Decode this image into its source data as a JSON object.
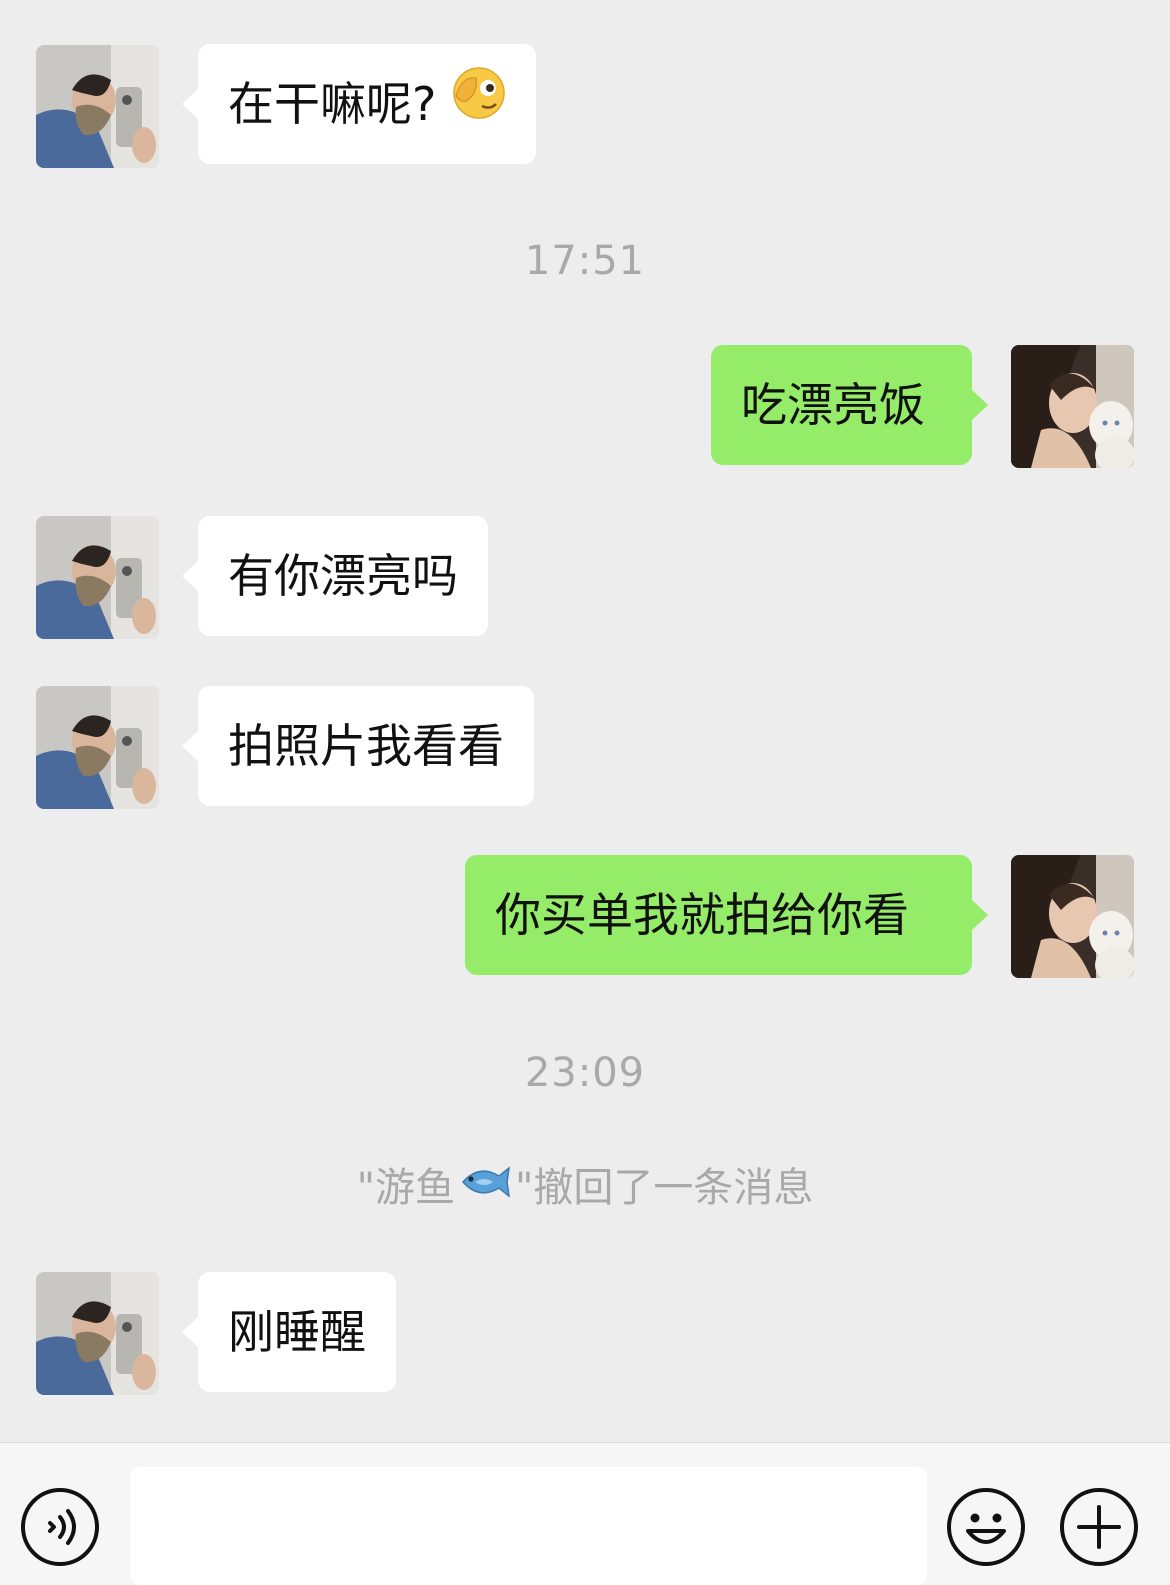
{
  "messages": {
    "m1": {
      "text": "在干嘛呢?",
      "emoji": "face-with-hand-over-eye-icon"
    },
    "t1": "17:51",
    "m2": {
      "text": "吃漂亮饭"
    },
    "m3": {
      "text": "有你漂亮吗"
    },
    "m4": {
      "text": "拍照片我看看"
    },
    "m5": {
      "text": "你买单我就拍给你看"
    },
    "t2": "23:09",
    "recall": {
      "prefix": "\"游鱼",
      "suffix": "\"撤回了一条消息",
      "emoji": "fish-icon"
    },
    "m6": {
      "text": "刚睡醒"
    }
  },
  "input_bar": {
    "value": "",
    "icons": [
      "voice-icon",
      "emoji-icon",
      "plus-icon"
    ]
  },
  "colors": {
    "background": "#ededed",
    "incoming_bubble": "#ffffff",
    "outgoing_bubble": "#95ec69",
    "timestamp": "#a9a9a9"
  }
}
